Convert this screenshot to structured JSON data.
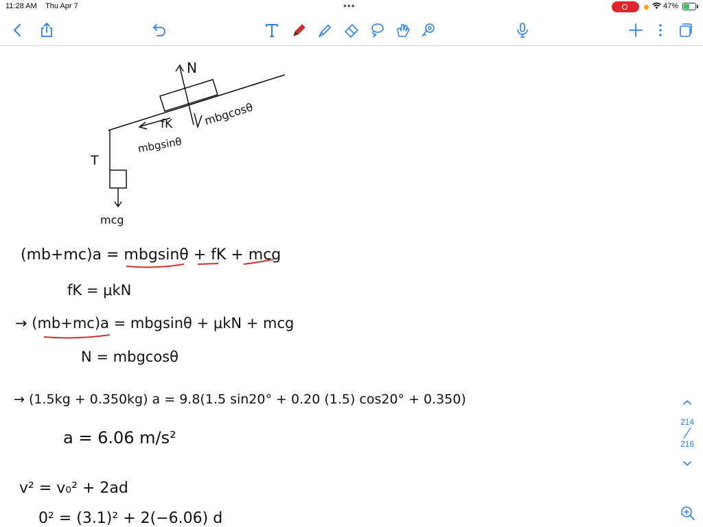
{
  "status": {
    "time": "11:28 AM",
    "date": "Thu Apr 7",
    "battery": "47%",
    "battery_level": 0.47
  },
  "colors": {
    "accent": "#2f80ed",
    "pen_red": "#d0312d",
    "record": "#e0262c"
  },
  "toolbar": {
    "left": [
      {
        "name": "back-button",
        "icon": "chevron-left-icon"
      },
      {
        "name": "share-button",
        "icon": "share-icon"
      },
      {
        "name": "undo-button",
        "icon": "undo-icon"
      }
    ],
    "tools": [
      {
        "name": "text-tool",
        "icon": "text-icon"
      },
      {
        "name": "pen-tool",
        "icon": "pen-icon"
      },
      {
        "name": "highlighter-tool",
        "icon": "highlighter-icon"
      },
      {
        "name": "eraser-tool",
        "icon": "eraser-icon"
      },
      {
        "name": "lasso-tool",
        "icon": "lasso-icon"
      },
      {
        "name": "image-tool",
        "icon": "image-icon"
      },
      {
        "name": "shape-tool",
        "icon": "shape-icon"
      }
    ],
    "right": [
      {
        "name": "microphone-button",
        "icon": "microphone-icon"
      },
      {
        "name": "add-button",
        "icon": "plus-icon"
      },
      {
        "name": "more-button",
        "icon": "more-vertical-icon"
      },
      {
        "name": "pages-button",
        "icon": "pages-icon"
      }
    ]
  },
  "notes": {
    "diagram": {
      "normal": "N",
      "normal_component": "mbgcosθ",
      "friction": "fK",
      "parallel_component": "mbgsinθ",
      "tension": "T",
      "weight": "mcg"
    },
    "lines": [
      "(mb+mc)a = mbgsinθ + fK + mcg",
      "fK = μkN",
      "→ (mb+mc)a = mbgsinθ + μkN + mcg",
      "N = mbgcosθ",
      "→ (1.5kg + 0.350kg) a = 9.8(1.5 sin20° + 0.20 (1.5) cos20° + 0.350)",
      "a = 6.06 m/s²",
      "v² = v₀² + 2ad",
      "0² = (3.1)² + 2(−6.06) d"
    ]
  },
  "pager": {
    "current": "214",
    "total": "216"
  }
}
